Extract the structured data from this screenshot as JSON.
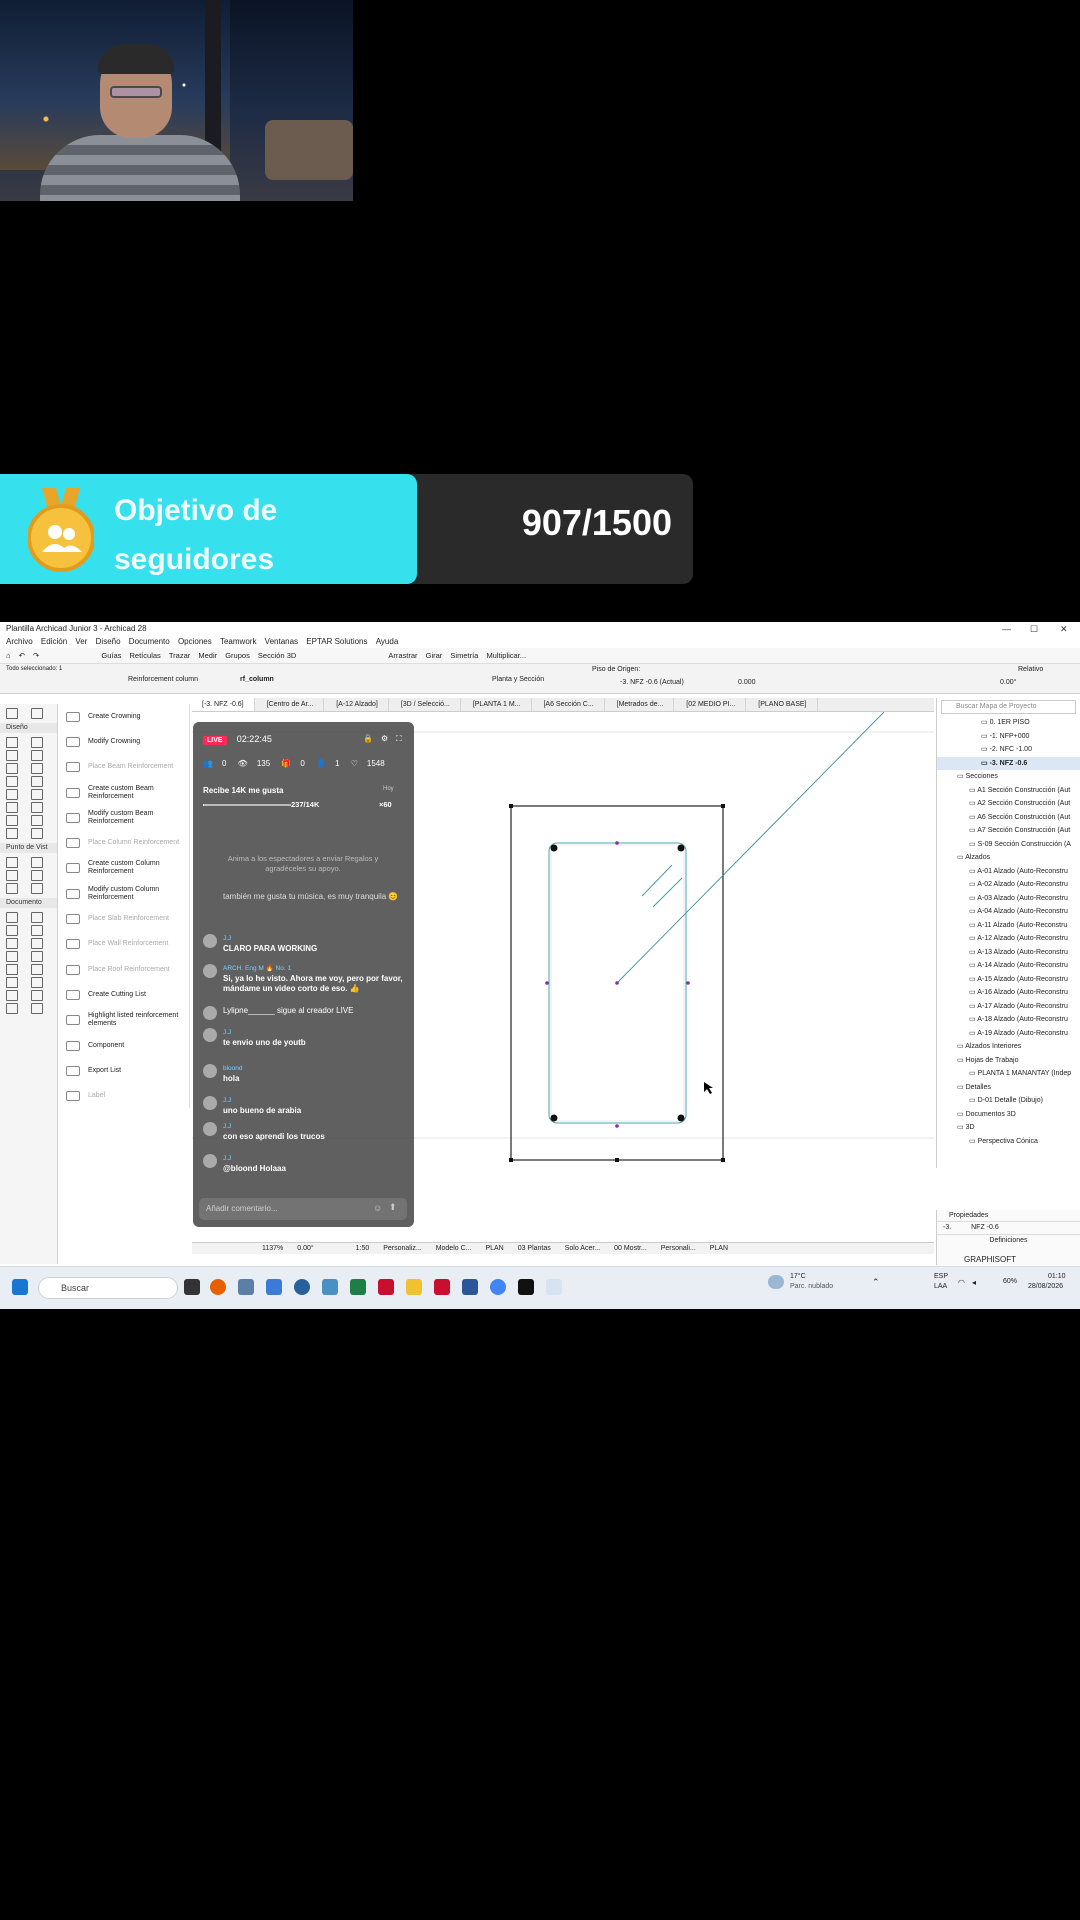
{
  "goal": {
    "title": "Objetivo de seguidores",
    "count": "907/1500"
  },
  "window": {
    "title": "Plantilla Archicad Junior 3 - Archicad 28",
    "controls": [
      "—",
      "☐",
      "✕"
    ]
  },
  "menu": [
    "Archivo",
    "Edición",
    "Ver",
    "Diseño",
    "Documento",
    "Opciones",
    "Teamwork",
    "Ventanas",
    "EPTAR Solutions",
    "Ayuda"
  ],
  "toolbar": [
    "Guías",
    "Retículas",
    "Trazar",
    "Medir",
    "Grupos",
    "Sección 3D",
    "Arrastrar",
    "Girar",
    "Simetría",
    "Multiplicar..."
  ],
  "infobox": {
    "selected": "Todo seleccionado: 1",
    "favorite": "Reinforcement column",
    "name": "rf_column",
    "layer_combo": "Planta y Sección",
    "origin_label": "Piso de Origen:",
    "origin_value": "-3. NFZ -0.6 (Actual)",
    "offset": "0.000",
    "relative": "Relativo",
    "angle": "0.00°"
  },
  "toolbox": {
    "design": "Diseño",
    "viewpoint": "Punto de Vist",
    "document": "Documento"
  },
  "palette": [
    {
      "label": "Create Crowning",
      "disabled": false
    },
    {
      "label": "Modify Crowning",
      "disabled": false
    },
    {
      "label": "Place Beam Reinforcement",
      "disabled": true
    },
    {
      "label": "Create custom Beam Reinforcement",
      "disabled": false
    },
    {
      "label": "Modify custom Beam Reinforcement",
      "disabled": false
    },
    {
      "label": "Place Column Reinforcement",
      "disabled": true
    },
    {
      "label": "Create custom Column Reinforcement",
      "disabled": false
    },
    {
      "label": "Modify custom Column Reinforcement",
      "disabled": false
    },
    {
      "label": "Place Slab Reinforcement",
      "disabled": true
    },
    {
      "label": "Place Wall Reinforcement",
      "disabled": true
    },
    {
      "label": "Place Roof Reinforcement",
      "disabled": true
    },
    {
      "label": "Create Cutting List",
      "disabled": false
    },
    {
      "label": "Highlight listed reinforcement elements",
      "disabled": false
    },
    {
      "label": "Component",
      "disabled": false
    },
    {
      "label": "Export List",
      "disabled": false
    },
    {
      "label": "Label",
      "disabled": true
    }
  ],
  "tabs": [
    "[-3. NFZ -0.6]",
    "[Centro de Ar...",
    "[A-12 Alzado]",
    "[3D / Selecció...",
    "[PLANTA 1 M...",
    "[A6 Sección C...",
    "[Metrados de...",
    "[02 MEDIO PI...",
    "[PLANO BASE]"
  ],
  "navigator": {
    "search_placeholder": "Buscar Mapa de Proyecto",
    "rows": [
      {
        "label": "0. 1ER PISO",
        "indent": 3,
        "bold": false
      },
      {
        "label": "-1. NFP+000",
        "indent": 3,
        "bold": false
      },
      {
        "label": "-2. NFC -1.00",
        "indent": 3,
        "bold": false
      },
      {
        "label": "-3. NFZ -0.6",
        "indent": 3,
        "bold": true
      },
      {
        "label": "Secciones",
        "indent": 1,
        "bold": false
      },
      {
        "label": "A1 Sección Construcción (Aut",
        "indent": 2,
        "bold": false
      },
      {
        "label": "A2 Sección Construcción (Aut",
        "indent": 2,
        "bold": false
      },
      {
        "label": "A6 Sección Construcción (Aut",
        "indent": 2,
        "bold": false
      },
      {
        "label": "A7 Sección Construcción (Aut",
        "indent": 2,
        "bold": false
      },
      {
        "label": "S-09 Sección Construcción (A",
        "indent": 2,
        "bold": false
      },
      {
        "label": "Alzados",
        "indent": 1,
        "bold": false
      },
      {
        "label": "A-01 Alzado (Auto-Reconstru",
        "indent": 2,
        "bold": false
      },
      {
        "label": "A-02 Alzado (Auto-Reconstru",
        "indent": 2,
        "bold": false
      },
      {
        "label": "A-03 Alzado (Auto-Reconstru",
        "indent": 2,
        "bold": false
      },
      {
        "label": "A-04 Alzado (Auto-Reconstru",
        "indent": 2,
        "bold": false
      },
      {
        "label": "A-11 Alzado (Auto-Reconstru",
        "indent": 2,
        "bold": false
      },
      {
        "label": "A-12 Alzado (Auto-Reconstru",
        "indent": 2,
        "bold": false
      },
      {
        "label": "A-13 Alzado (Auto-Reconstru",
        "indent": 2,
        "bold": false
      },
      {
        "label": "A-14 Alzado (Auto-Reconstru",
        "indent": 2,
        "bold": false
      },
      {
        "label": "A-15 Alzado (Auto-Reconstru",
        "indent": 2,
        "bold": false
      },
      {
        "label": "A-16 Alzado (Auto-Reconstru",
        "indent": 2,
        "bold": false
      },
      {
        "label": "A-17 Alzado (Auto-Reconstru",
        "indent": 2,
        "bold": false
      },
      {
        "label": "A-18 Alzado (Auto-Reconstru",
        "indent": 2,
        "bold": false
      },
      {
        "label": "A-19 Alzado (Auto-Reconstru",
        "indent": 2,
        "bold": false
      },
      {
        "label": "Alzados Interiores",
        "indent": 1,
        "bold": false
      },
      {
        "label": "Hojas de Trabajo",
        "indent": 1,
        "bold": false
      },
      {
        "label": "PLANTA 1 MANANTAY (Indep",
        "indent": 2,
        "bold": false
      },
      {
        "label": "Detalles",
        "indent": 1,
        "bold": false
      },
      {
        "label": "D-01 Detalle (Dibujo)",
        "indent": 2,
        "bold": false
      },
      {
        "label": "Documentos 3D",
        "indent": 1,
        "bold": false
      },
      {
        "label": "3D",
        "indent": 1,
        "bold": false
      },
      {
        "label": "Perspectiva Cónica",
        "indent": 2,
        "bold": false
      }
    ]
  },
  "properties": {
    "header": "Propiedades",
    "id": "-3.",
    "story": "NFZ -0.6",
    "definitions": "Definiciones"
  },
  "statusbar": [
    "1137%",
    "0.00°",
    "1:50",
    "Personaliz...",
    "Modelo C...",
    "PLAN",
    "03 Plantas",
    "Solo Acer...",
    "00 Mostr...",
    "Personali...",
    "PLAN"
  ],
  "graphisoft": "GRAPHISOFT",
  "taskbar": {
    "search": "Buscar",
    "weather_temp": "17°C",
    "weather_desc": "Parc. nublado",
    "lang": "ESP",
    "lang2": "LAA",
    "battery": "60%",
    "time": "01:10",
    "date": "28/08/2026"
  },
  "live": {
    "badge": "LIVE",
    "timer": "02:22:45",
    "stats": [
      "0",
      "135",
      "0",
      "1",
      "1548"
    ],
    "goal_text": "Recibe 14K me gusta",
    "goal_day": "Hoy",
    "goal_progress": "237/14K",
    "goal_bonus": "×60",
    "goal_fraction": 0.017,
    "tip": "Anima a los espectadores a enviar Regalos y agradéceles su apoyo.",
    "messages": [
      {
        "user": "",
        "text": "también me gusta tu música, es muy tranquila 😊"
      },
      {
        "user": "J.J",
        "text": "CLARO PARA WORKING"
      },
      {
        "user": "ARCH. Eng M 🔥 No. 1",
        "text": "Si, ya lo he visto. Ahora me voy, pero por favor, mándame un video corto de eso. 👍"
      },
      {
        "user": "",
        "text": "Lylipne______ sigue al creador LIVE"
      },
      {
        "user": "J.J",
        "text": "te envio uno de youtb"
      },
      {
        "user": "bloond",
        "text": "hola"
      },
      {
        "user": "J.J",
        "text": "uno bueno de arabia"
      },
      {
        "user": "J.J",
        "text": "con eso aprendi los trucos"
      },
      {
        "user": "J.J",
        "text": "@bloond Holaaa"
      }
    ],
    "comment_placeholder": "Añadir comentario..."
  }
}
